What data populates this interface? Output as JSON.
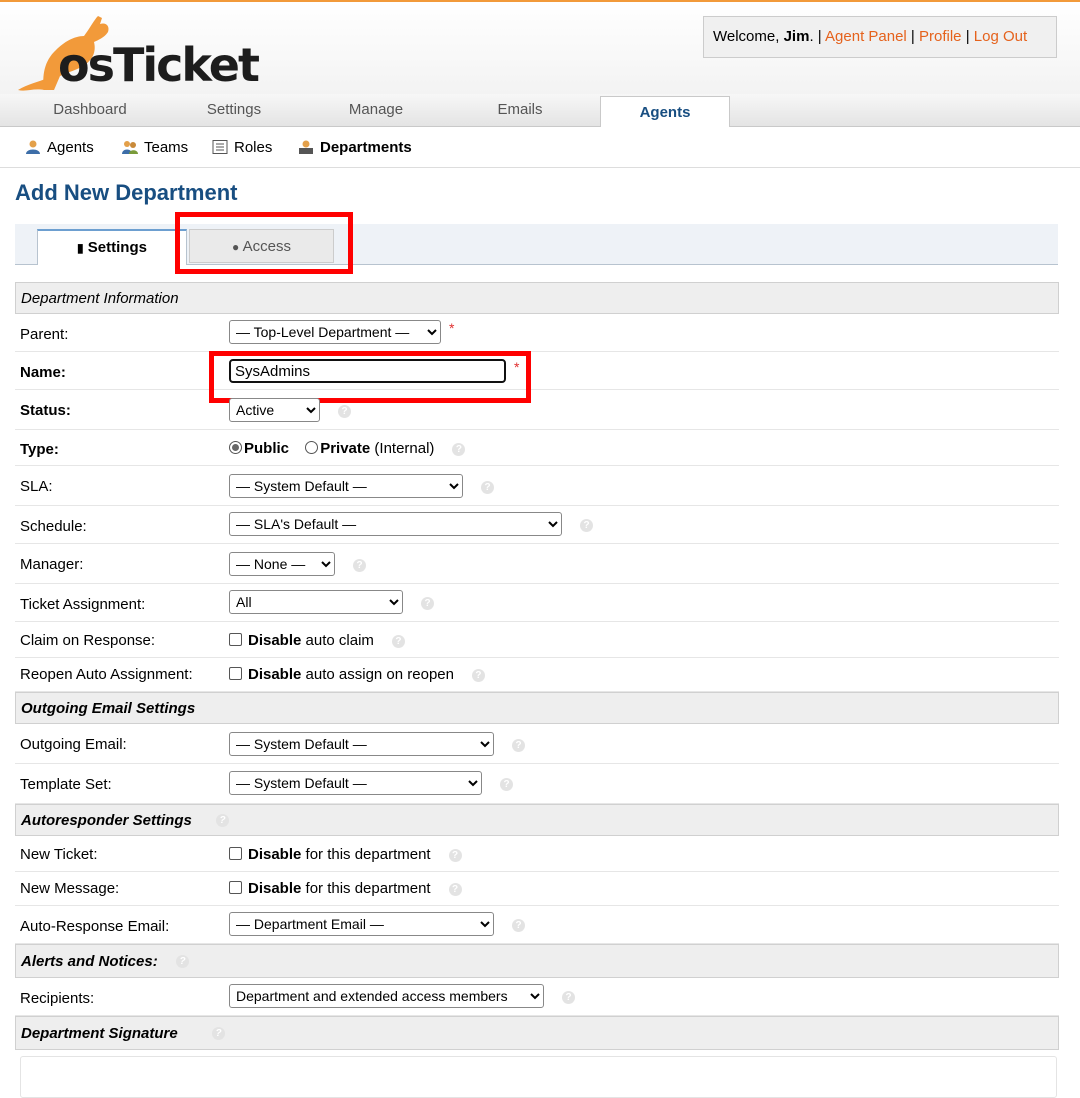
{
  "header": {
    "logo_text": "osTicket",
    "welcome_prefix": "Welcome,",
    "user_name": "Jim",
    "welcome_sep": ".",
    "links": [
      "Agent Panel",
      "Profile",
      "Log Out"
    ]
  },
  "main_tabs": [
    "Dashboard",
    "Settings",
    "Manage",
    "Emails",
    "Agents"
  ],
  "active_main_tab": "Agents",
  "sub_nav": [
    "Agents",
    "Teams",
    "Roles",
    "Departments"
  ],
  "page_title": "Add New Department",
  "form_tabs": [
    "Settings",
    "Access"
  ],
  "sections": {
    "info": "Department Information",
    "email": "Outgoing Email Settings",
    "autoresp": "Autoresponder Settings",
    "alerts": "Alerts and Notices:",
    "signature": "Department Signature"
  },
  "fields": {
    "parent": {
      "label": "Parent:",
      "value": "— Top-Level Department —",
      "required": "*"
    },
    "name": {
      "label": "Name:",
      "value": "SysAdmins",
      "required": "*"
    },
    "status": {
      "label": "Status:",
      "value": "Active"
    },
    "type": {
      "label": "Type:",
      "opt1": "Public",
      "opt2": "Private",
      "opt2_suffix": "(Internal)"
    },
    "sla": {
      "label": "SLA:",
      "value": "— System Default —"
    },
    "schedule": {
      "label": "Schedule:",
      "value": "— SLA's Default —"
    },
    "manager": {
      "label": "Manager:",
      "value": "— None —"
    },
    "ticket_assignment": {
      "label": "Ticket Assignment:",
      "value": "All"
    },
    "claim": {
      "label": "Claim on Response:",
      "bold": "Disable",
      "text": "auto claim"
    },
    "reopen": {
      "label": "Reopen Auto Assignment:",
      "bold": "Disable",
      "text": "auto assign on reopen"
    },
    "outgoing_email": {
      "label": "Outgoing Email:",
      "value": "— System Default —"
    },
    "template_set": {
      "label": "Template Set:",
      "value": "— System Default —"
    },
    "new_ticket": {
      "label": "New Ticket:",
      "bold": "Disable",
      "text": "for this department"
    },
    "new_message": {
      "label": "New Message:",
      "bold": "Disable",
      "text": "for this department"
    },
    "auto_response_email": {
      "label": "Auto-Response Email:",
      "value": "— Department Email —"
    },
    "recipients": {
      "label": "Recipients:",
      "value": "Department and extended access members"
    }
  },
  "colors": {
    "accent": "#e5621c",
    "title": "#184e81",
    "highlight": "#ff0000"
  }
}
